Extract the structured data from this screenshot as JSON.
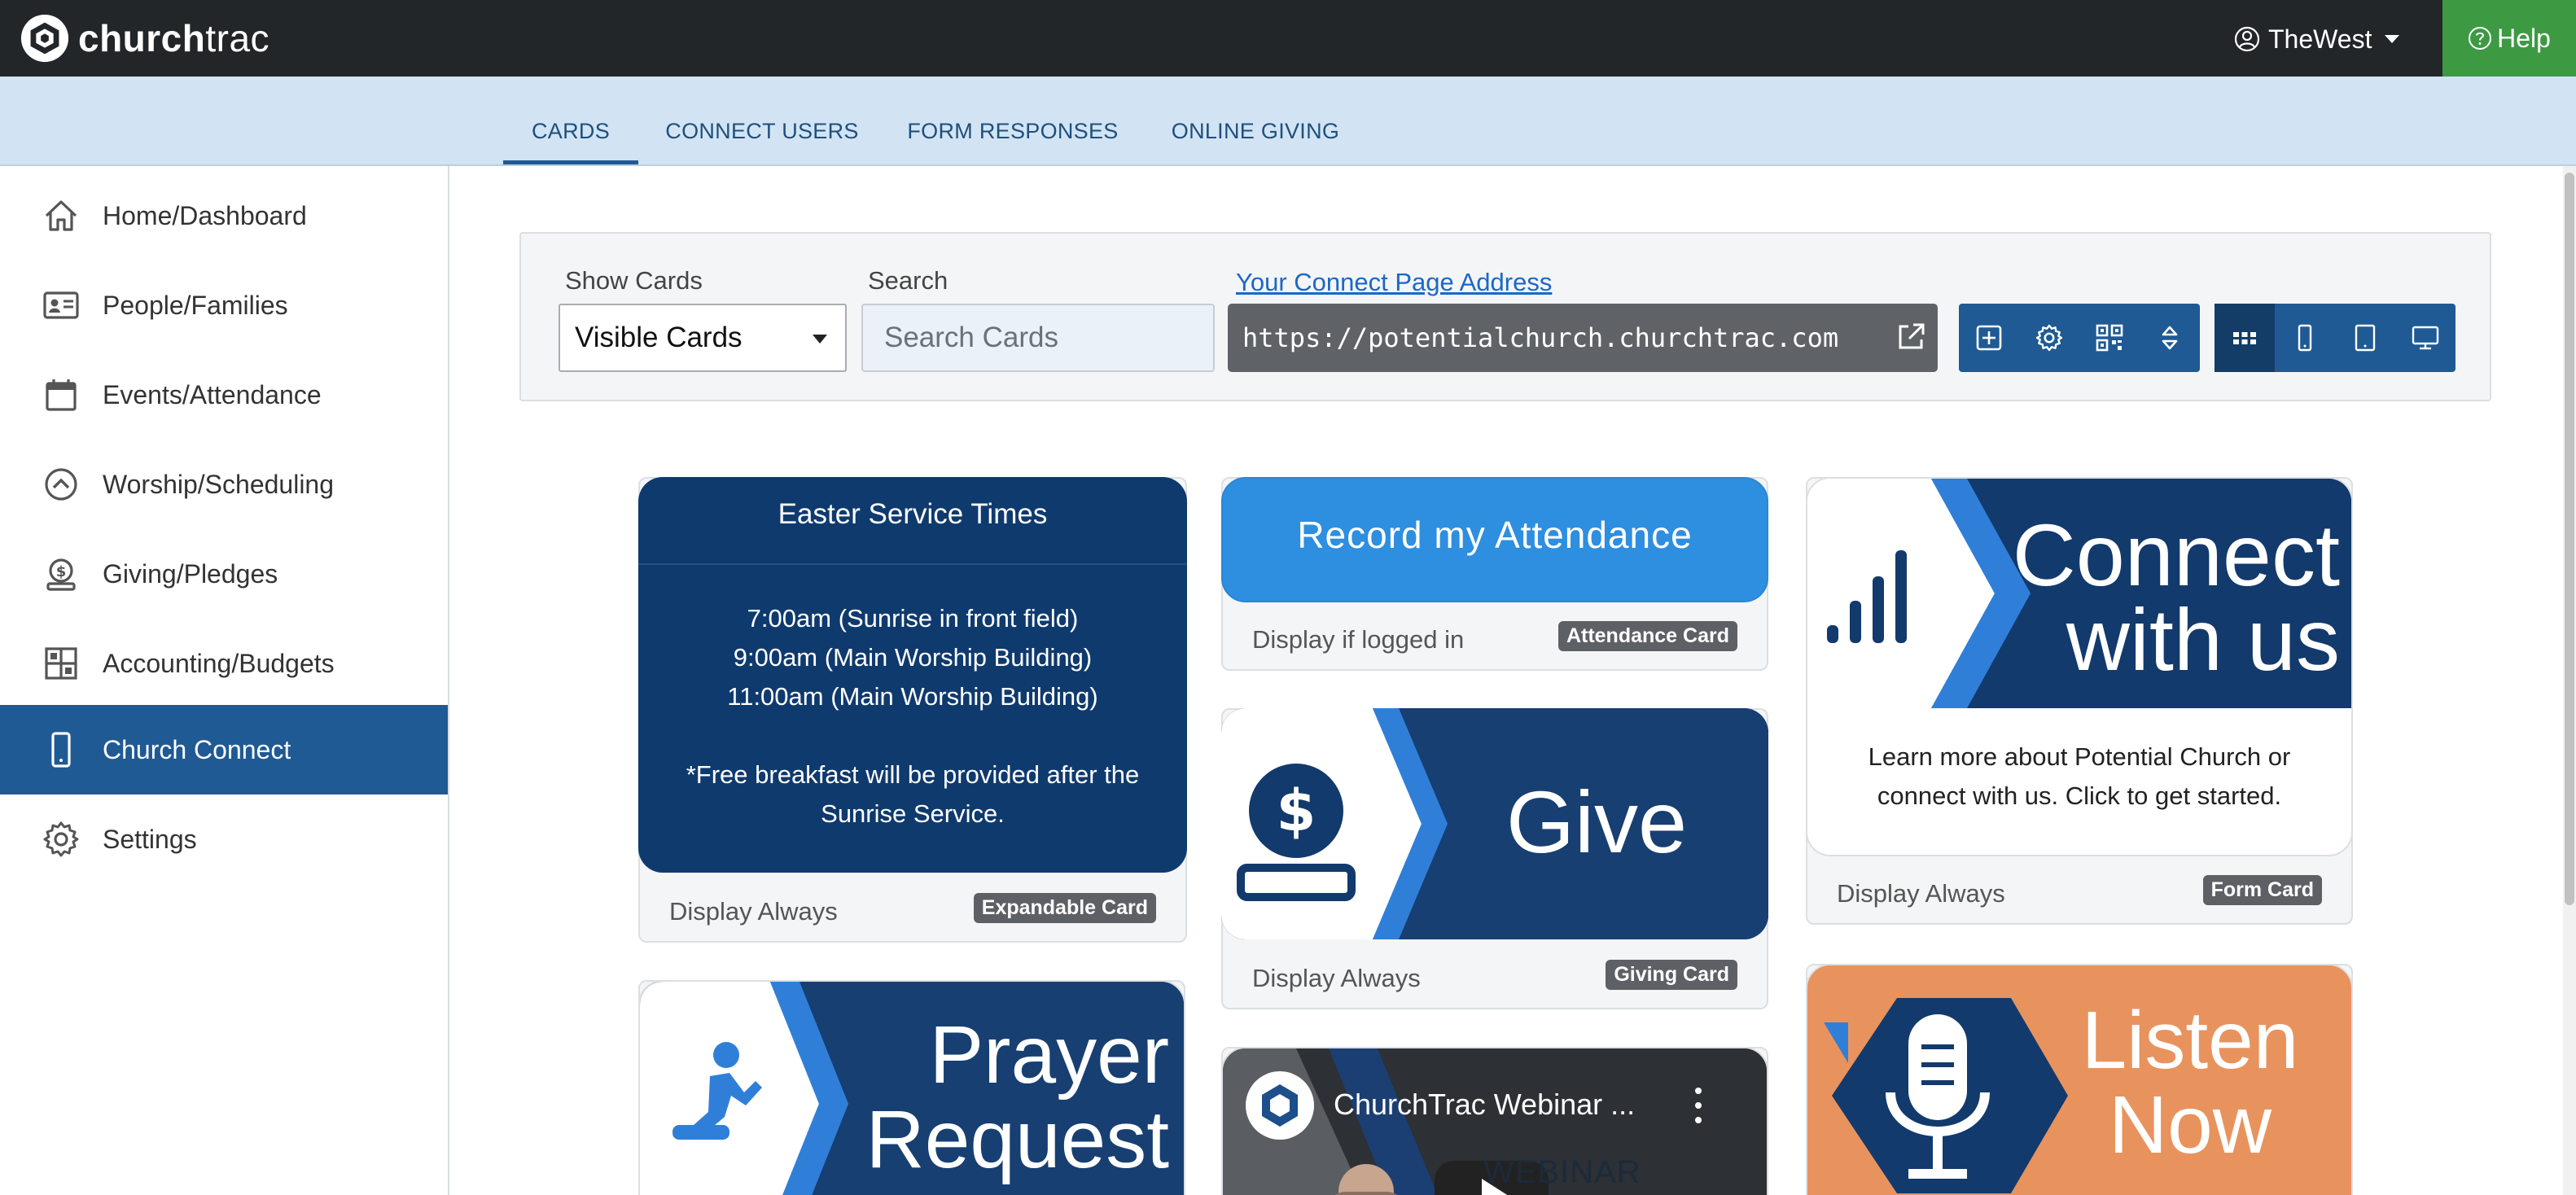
{
  "app": {
    "logo_bold": "church",
    "logo_light": "trac"
  },
  "topbar": {
    "user_name": "TheWest",
    "help_label": "Help"
  },
  "tabs": [
    {
      "label": "CARDS",
      "active": true
    },
    {
      "label": "CONNECT USERS",
      "active": false
    },
    {
      "label": "FORM RESPONSES",
      "active": false
    },
    {
      "label": "ONLINE GIVING",
      "active": false
    }
  ],
  "sidebar": {
    "items": [
      {
        "label": "Home/Dashboard",
        "icon": "home-icon"
      },
      {
        "label": "People/Families",
        "icon": "id-card-icon"
      },
      {
        "label": "Events/Attendance",
        "icon": "calendar-icon"
      },
      {
        "label": "Worship/Scheduling",
        "icon": "chevron-circle-icon"
      },
      {
        "label": "Giving/Pledges",
        "icon": "donate-icon"
      },
      {
        "label": "Accounting/Budgets",
        "icon": "grid-icon"
      },
      {
        "label": "Church Connect",
        "icon": "phone-icon",
        "active": true
      },
      {
        "label": "Settings",
        "icon": "gear-icon"
      }
    ]
  },
  "toolbar": {
    "show_cards_label": "Show Cards",
    "show_cards_value": "Visible Cards",
    "search_label": "Search",
    "search_placeholder": "Search Cards",
    "connect_link": "Your Connect Page Address",
    "connect_url": "https://potentialchurch.churchtrac.com"
  },
  "cards": {
    "easter": {
      "title": "Easter Service Times",
      "line1": "7:00am (Sunrise in front field)",
      "line2": "9:00am (Main Worship Building)",
      "line3": "11:00am (Main Worship Building)",
      "line4": "*Free breakfast will be provided after the",
      "line5": "Sunrise Service.",
      "display": "Display Always",
      "badge": "Expandable Card"
    },
    "attendance": {
      "title": "Record my Attendance",
      "display": "Display if logged in",
      "badge": "Attendance Card"
    },
    "connect": {
      "line1": "Connect",
      "line2": "with us",
      "desc1": "Learn more about Potential Church or",
      "desc2": "connect with us. Click to get started.",
      "display": "Display Always",
      "badge": "Form Card"
    },
    "give": {
      "word": "Give",
      "display": "Display Always",
      "badge": "Giving Card"
    },
    "prayer": {
      "line1": "Prayer",
      "line2": "Request"
    },
    "webinar": {
      "title": "ChurchTrac Webinar ...",
      "overlay": "WEBINAR"
    },
    "listen": {
      "line1": "Listen",
      "line2": "Now"
    }
  },
  "colors": {
    "topbar": "#222628",
    "accent_blue": "#1f5a94",
    "card_navy": "#0f3a6e",
    "bright_blue": "#2e8ee0",
    "help_green": "#3d9a43",
    "listen_orange": "#e89462"
  }
}
